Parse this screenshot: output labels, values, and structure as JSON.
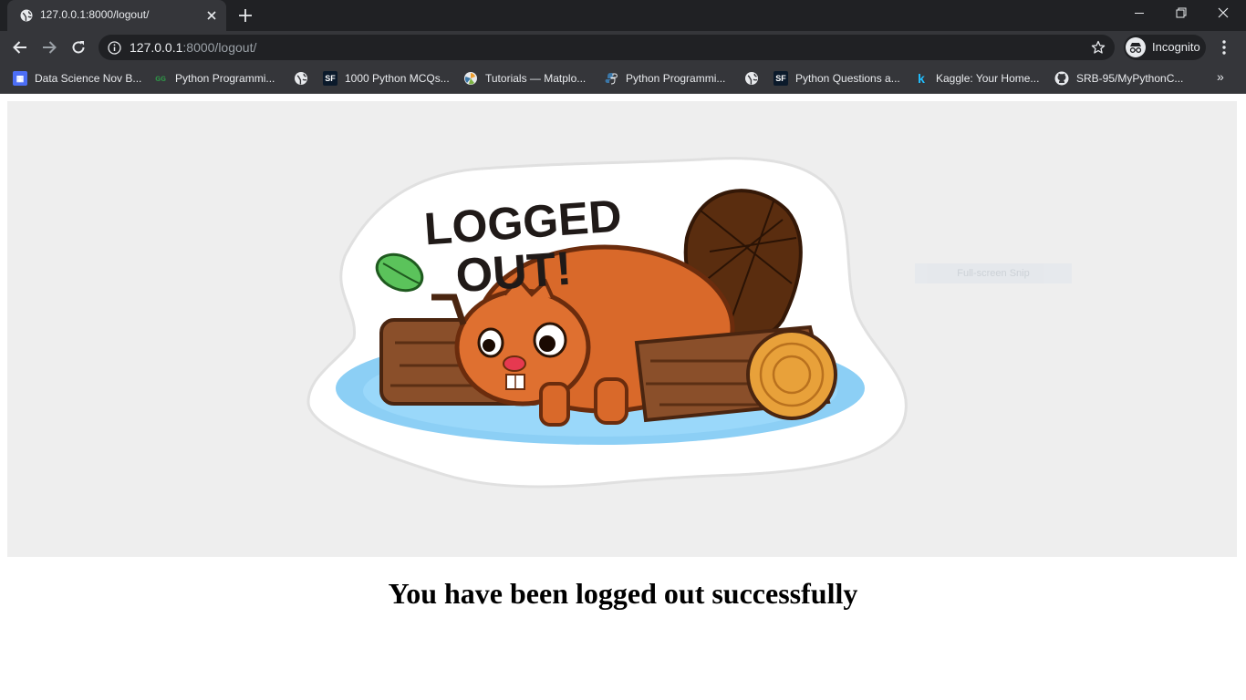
{
  "browser": {
    "tab": {
      "title": "127.0.0.1:8000/logout/",
      "favicon": "globe-icon"
    },
    "address": {
      "host": "127.0.0.1",
      "path": ":8000/logout/"
    },
    "profile_label": "Incognito",
    "bookmarks": [
      {
        "label": "Data Science Nov B...",
        "icon": "calendar-icon",
        "color": "#4c6ef5"
      },
      {
        "label": "Python Programmi...",
        "icon": "gfg-icon",
        "color": "#2f8d46"
      },
      {
        "label": "",
        "icon": "globe-icon",
        "color": "#e8eaed"
      },
      {
        "label": "1000 Python MCQs...",
        "icon": "sf-icon",
        "color": "#0b1a2b"
      },
      {
        "label": "Tutorials — Matplo...",
        "icon": "matplotlib-icon",
        "color": "#e8eaed"
      },
      {
        "label": "Python Programmi...",
        "icon": "python-icon",
        "color": "#3b77a8"
      },
      {
        "label": "",
        "icon": "globe-icon",
        "color": "#e8eaed"
      },
      {
        "label": "Python Questions a...",
        "icon": "sf-icon",
        "color": "#0b1a2b"
      },
      {
        "label": "Kaggle: Your Home...",
        "icon": "kaggle-icon",
        "color": "#20beff"
      },
      {
        "label": "SRB-95/MyPythonC...",
        "icon": "github-icon",
        "color": "#e8eaed"
      }
    ],
    "bookmarks_overflow": "»"
  },
  "page": {
    "image": {
      "sticker_text_line1": "LOGGED",
      "sticker_text_line2": "OUT!",
      "overlay": "Full-screen Snip"
    },
    "message": "You have been logged out successfully"
  }
}
